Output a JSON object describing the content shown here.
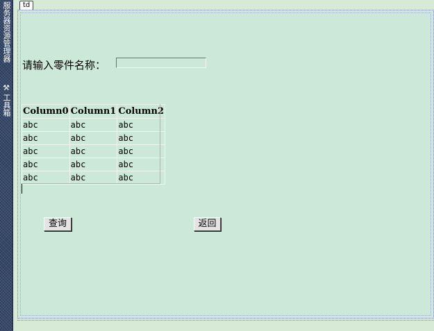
{
  "toolbox": {
    "label_top": "服务器资源管理器",
    "icon": "toolbox-icon",
    "label_bottom": "工具箱"
  },
  "tag": {
    "label": "td"
  },
  "form": {
    "part_name_label": "请输入零件名称：",
    "part_name_value": ""
  },
  "grid": {
    "columns": [
      "Column0",
      "Column1",
      "Column2"
    ],
    "rows": [
      [
        "abc",
        "abc",
        "abc"
      ],
      [
        "abc",
        "abc",
        "abc"
      ],
      [
        "abc",
        "abc",
        "abc"
      ],
      [
        "abc",
        "abc",
        "abc"
      ],
      [
        "abc",
        "abc",
        "abc"
      ]
    ]
  },
  "buttons": {
    "query": "查询",
    "back": "返回"
  }
}
